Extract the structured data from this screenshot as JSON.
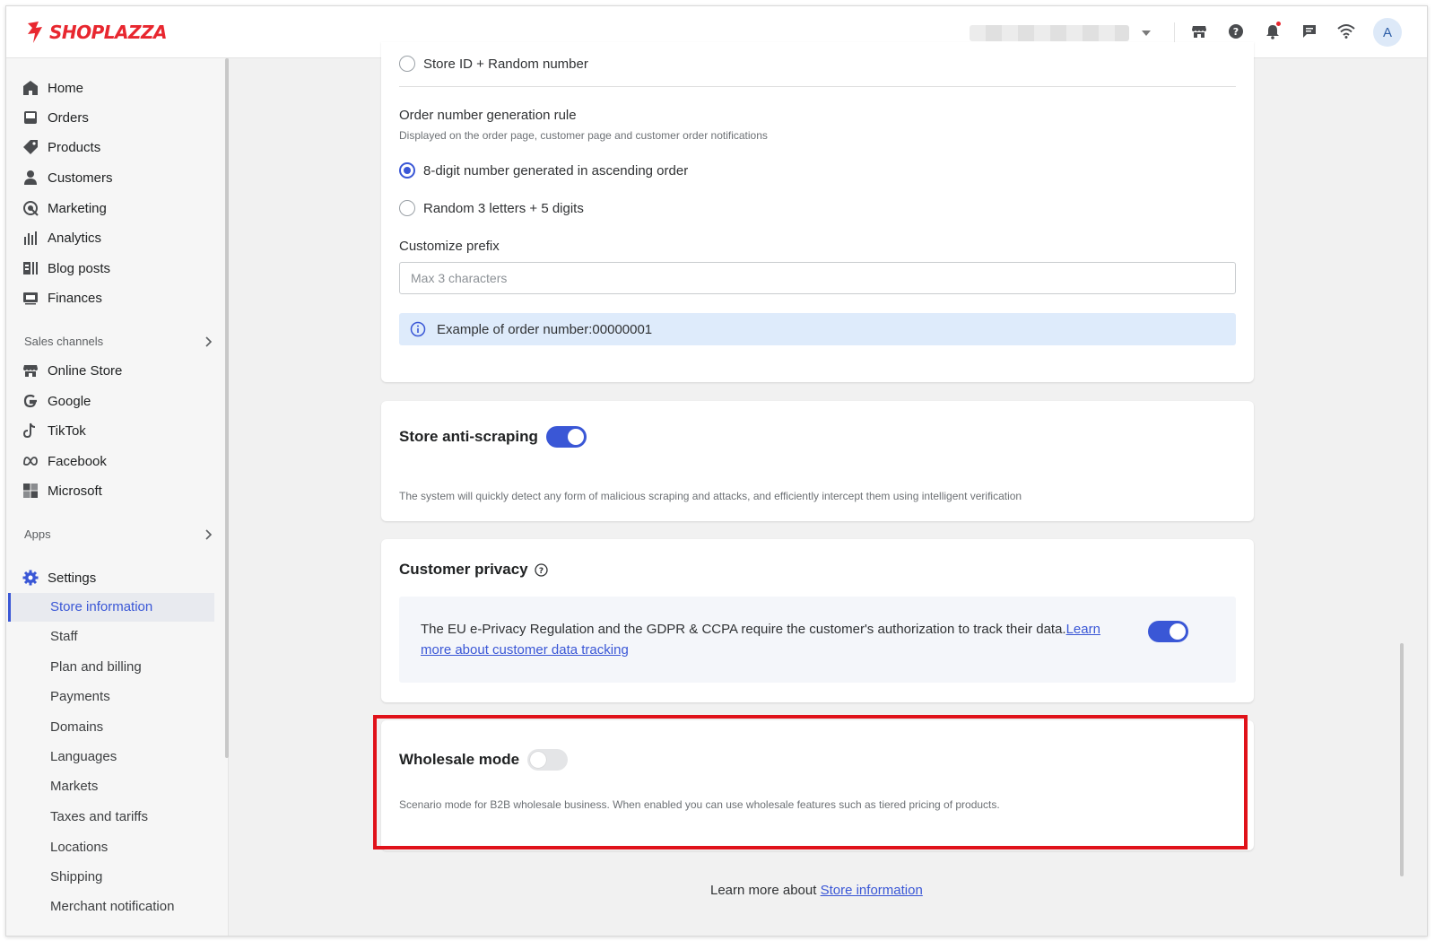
{
  "brand": {
    "name": "SHOPLAZZA",
    "color": "#e8272f"
  },
  "accent_color": "#3a57d6",
  "header": {
    "icons": [
      "store-icon",
      "help-icon",
      "bell-icon",
      "chat-icon",
      "wifi-icon"
    ],
    "avatar_initial": "A"
  },
  "sidebar": {
    "main_items": [
      {
        "label": "Home",
        "icon": "home-icon"
      },
      {
        "label": "Orders",
        "icon": "orders-icon"
      },
      {
        "label": "Products",
        "icon": "tag-icon"
      },
      {
        "label": "Customers",
        "icon": "person-icon"
      },
      {
        "label": "Marketing",
        "icon": "marketing-icon"
      },
      {
        "label": "Analytics",
        "icon": "bar-chart-icon"
      },
      {
        "label": "Blog posts",
        "icon": "blog-icon"
      },
      {
        "label": "Finances",
        "icon": "finances-icon"
      }
    ],
    "sales_channels_label": "Sales channels",
    "sales_channels": [
      {
        "label": "Online Store",
        "icon": "store-icon"
      },
      {
        "label": "Google",
        "icon": "google-icon"
      },
      {
        "label": "TikTok",
        "icon": "tiktok-icon"
      },
      {
        "label": "Facebook",
        "icon": "meta-icon"
      },
      {
        "label": "Microsoft",
        "icon": "microsoft-icon"
      }
    ],
    "apps_label": "Apps",
    "settings_label": "Settings",
    "settings_items": [
      "Store information",
      "Staff",
      "Plan and billing",
      "Payments",
      "Domains",
      "Languages",
      "Markets",
      "Taxes and tariffs",
      "Locations",
      "Shipping",
      "Merchant notification"
    ],
    "active_settings_item": "Store information"
  },
  "order_number": {
    "prev_option": "Store ID + Random number",
    "rule_label": "Order number generation rule",
    "rule_desc": "Displayed on the order page, customer page and customer order notifications",
    "options": [
      {
        "label": "8-digit number generated in ascending order",
        "checked": true
      },
      {
        "label": "Random 3 letters + 5 digits",
        "checked": false
      }
    ],
    "prefix_label": "Customize prefix",
    "prefix_placeholder": "Max 3 characters",
    "prefix_value": "",
    "example_text": "Example of order number:00000001"
  },
  "anti_scraping": {
    "title": "Store anti-scraping",
    "enabled": true,
    "desc": "The system will quickly detect any form of malicious scraping and attacks, and efficiently intercept them using intelligent verification"
  },
  "customer_privacy": {
    "title": "Customer privacy",
    "text": "The EU e-Privacy Regulation and the GDPR & CCPA require the customer's authorization to track their data.",
    "link_text": "Learn more about customer data tracking",
    "enabled": true
  },
  "wholesale": {
    "title": "Wholesale mode",
    "enabled": false,
    "desc": "Scenario mode for B2B wholesale business. When enabled you can use wholesale features such as tiered pricing of products."
  },
  "footer": {
    "prefix": "Learn more about ",
    "link_text": "Store information"
  }
}
